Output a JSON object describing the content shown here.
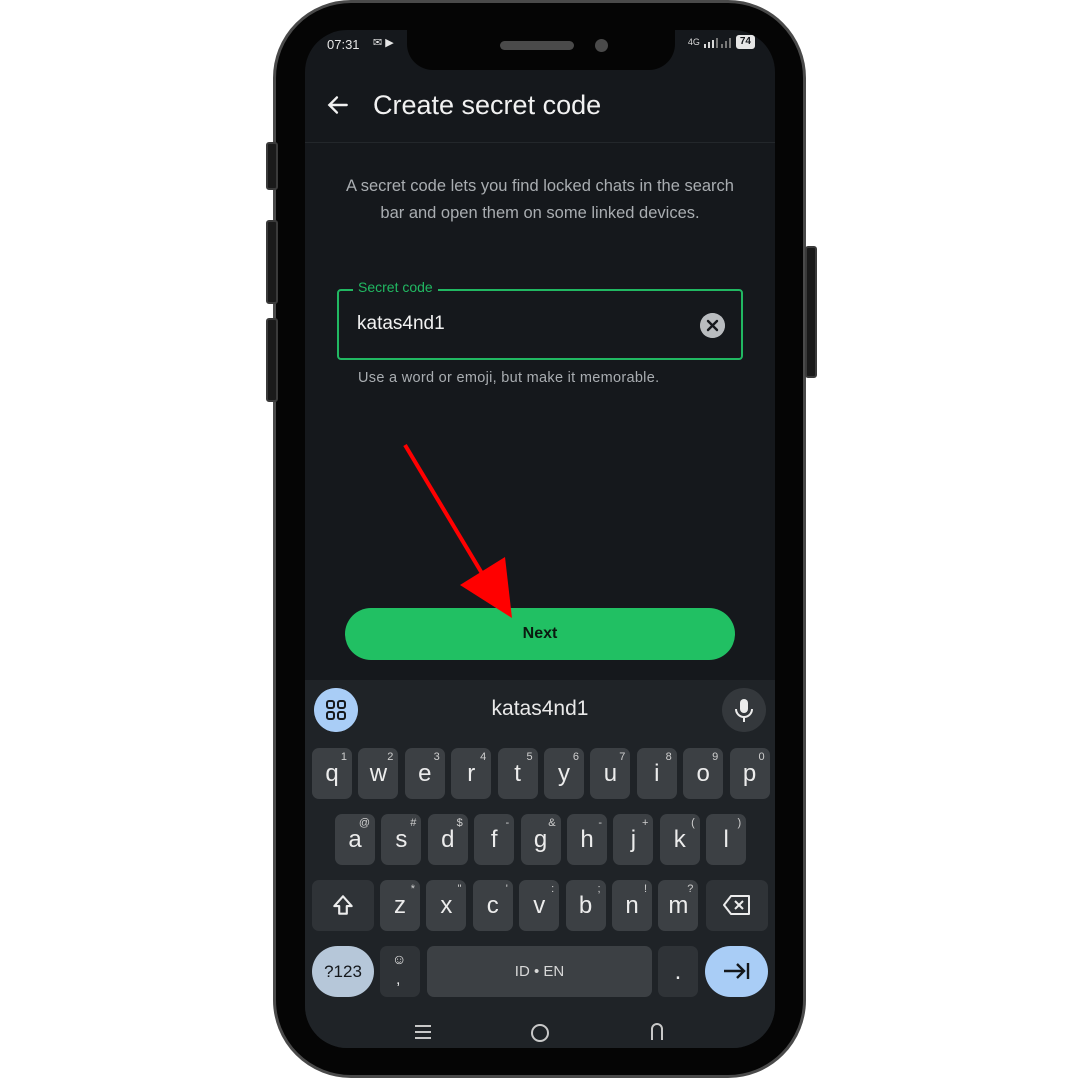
{
  "status_bar": {
    "time": "07:31",
    "network": "4G",
    "battery": "74"
  },
  "app_bar": {
    "title": "Create secret code",
    "back_icon": "arrow-left-icon"
  },
  "description": "A secret code lets you find locked chats in the search bar and open them on some linked devices.",
  "secret_code_field": {
    "label": "Secret code",
    "value": "katas4nd1",
    "helper": "Use a word or emoji, but make it memorable."
  },
  "next_button": {
    "label": "Next"
  },
  "keyboard": {
    "suggestion": "katas4nd1",
    "row1": [
      [
        "q",
        "1"
      ],
      [
        "w",
        "2"
      ],
      [
        "e",
        "3"
      ],
      [
        "r",
        "4"
      ],
      [
        "t",
        "5"
      ],
      [
        "y",
        "6"
      ],
      [
        "u",
        "7"
      ],
      [
        "i",
        "8"
      ],
      [
        "o",
        "9"
      ],
      [
        "p",
        "0"
      ]
    ],
    "row2": [
      [
        "a",
        "@"
      ],
      [
        "s",
        "#"
      ],
      [
        "d",
        "$"
      ],
      [
        "f",
        "-"
      ],
      [
        "g",
        "&"
      ],
      [
        "h",
        "-"
      ],
      [
        "j",
        "+"
      ],
      [
        "k",
        "("
      ],
      [
        "l",
        ")"
      ]
    ],
    "row3": [
      [
        "z",
        "*"
      ],
      [
        "x",
        "\""
      ],
      [
        "c",
        "'"
      ],
      [
        "v",
        ":"
      ],
      [
        "b",
        ";"
      ],
      [
        "n",
        "!"
      ],
      [
        "m",
        "?"
      ]
    ],
    "symbols_label": "?123",
    "comma_label": ",",
    "space_label": "ID • EN",
    "period_label": "."
  },
  "colors": {
    "accent": "#21c063",
    "background": "#15181c",
    "annotation_arrow": "#ff0000"
  }
}
